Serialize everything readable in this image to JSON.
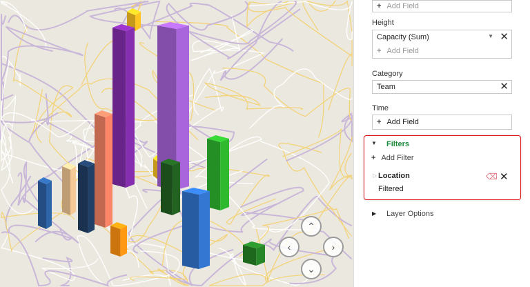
{
  "panel": {
    "top_add_field": "Add Field",
    "height": {
      "label": "Height",
      "field": "Capacity (Sum)",
      "add": "Add Field"
    },
    "category": {
      "label": "Category",
      "field": "Team"
    },
    "time": {
      "label": "Time",
      "add": "Add Field"
    },
    "filters": {
      "title": "Filters",
      "add": "Add Filter",
      "location": "Location",
      "status": "Filtered"
    },
    "layer_options": "Layer Options"
  },
  "nav": {
    "up": "⌃",
    "left": "‹",
    "right": "›",
    "down": "⌄"
  },
  "colors": {
    "accent_green": "#1e8a3c",
    "highlight_red": "#e0141e"
  }
}
